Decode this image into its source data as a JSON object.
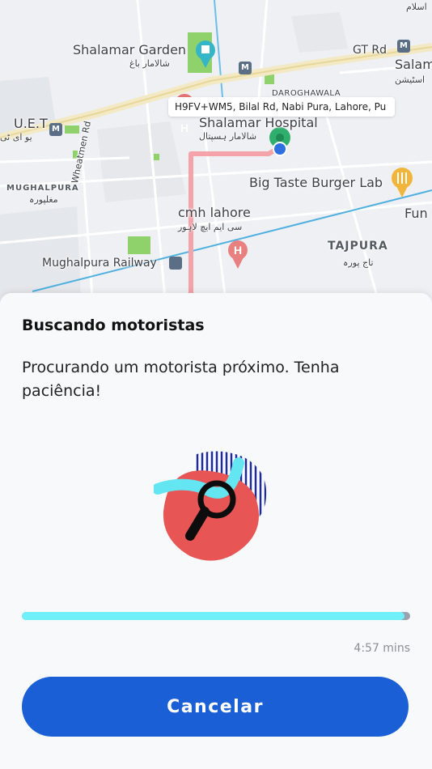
{
  "map": {
    "address": "H9FV+WM5, Bilal Rd, Nabi Pura, Lahore, Pu",
    "labels": {
      "islam": "اسلام",
      "shalamar_garden": "Shalamar Garden",
      "shalamar_garden_ur": "شالامار باغ",
      "gt_rd": "GT Rd",
      "salam": "Salam",
      "station_ur": "اسٹیشن",
      "daroghawala": "DAROGHAWALA",
      "uet": "U.E.T",
      "uet_ur": "یو ای ٹی",
      "shalamar_hospital": "Shalamar Hospital",
      "shalamar_hospital_ur": "شالامار ہسپتال",
      "wheatmen_rd": "Wheatmen Rd",
      "big_taste": "Big Taste Burger Lab",
      "mughalpura": "MUGHALPURA",
      "mughalpura_ur": "مغلپورہ",
      "cmh_lahore": "cmh lahore",
      "cmh_ur": "سی ایم ایچ لاہور",
      "fun": "Fun",
      "tajpura": "TAJPURA",
      "tajpura_ur": "تاج پورہ",
      "mughalpura_railway": "Mughalpura Railway",
      "metro_glyph": "M"
    },
    "route_color": "#f4a3a8",
    "marker_color": "#2fae6e",
    "location_color": "#2f6fe0"
  },
  "sheet": {
    "title": "Buscando motoristas",
    "message": "Procurando um motorista próximo. Tenha paciência!",
    "progress_fraction": 0.985,
    "timer": "4:57 mins",
    "cancel_label": "Cancelar",
    "accent": "#1b5fd6",
    "progress_color": "#6ff0fb"
  }
}
